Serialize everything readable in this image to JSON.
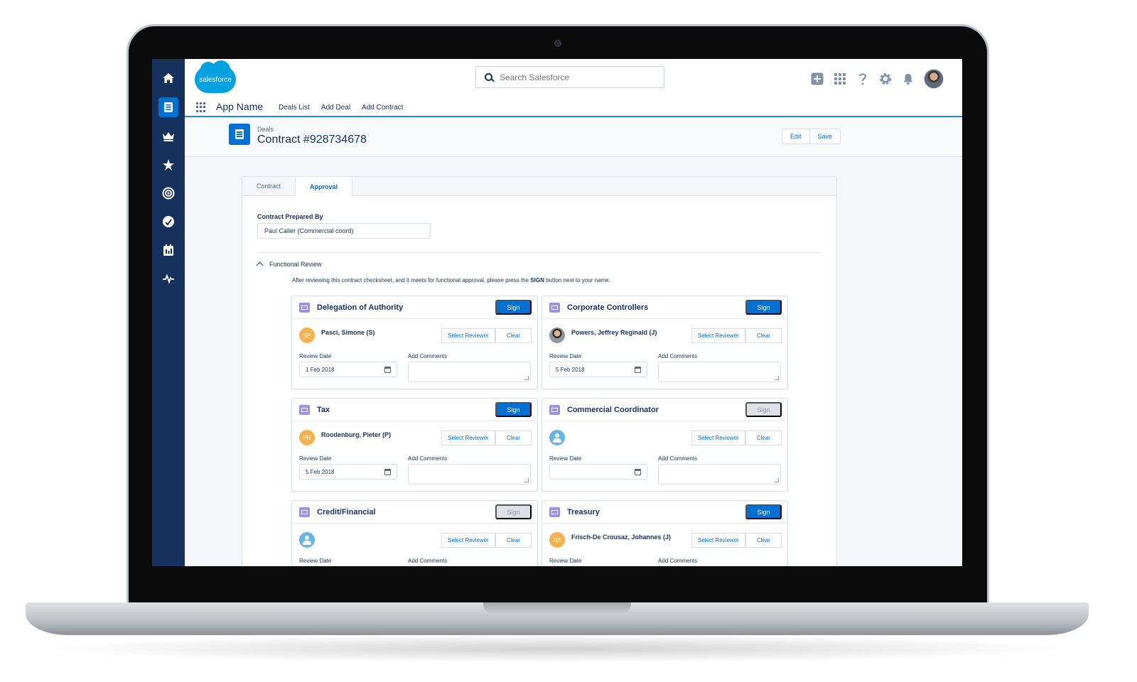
{
  "app": {
    "logo_text": "salesforce",
    "search_placeholder": "Search Salesforce",
    "app_name": "App Name",
    "nav": [
      "Deals List",
      "Add Deal",
      "Add Contract"
    ]
  },
  "sidebar_icons": [
    "home-icon",
    "contract-icon",
    "crown-icon",
    "person-star-icon",
    "target-icon",
    "gauge-icon",
    "calendar-board-icon",
    "pulse-icon"
  ],
  "header_icons": [
    "add-icon",
    "waffle-icon",
    "help-icon",
    "settings-icon",
    "bell-icon",
    "user-avatar"
  ],
  "record": {
    "eyebrow": "Deals",
    "title": "Contract #928734678",
    "edit_label": "Edit",
    "save_label": "Save"
  },
  "tabs": [
    {
      "label": "Contract",
      "active": false
    },
    {
      "label": "Approval",
      "active": true
    }
  ],
  "form": {
    "prepared_by_label": "Contract Prepared By",
    "prepared_by_value": "Paul Caller (Commercial coord)",
    "section_title": "Functional Review",
    "instructions_before": "After reviewing this contract checksheet, and it meets for functional approval, please press the",
    "instructions_bold": "SIGN",
    "instructions_after": "button next to your name."
  },
  "labels": {
    "sign": "Sign",
    "select_reviewer": "Select Reviewer",
    "clear": "Clear",
    "review_date": "Review Date",
    "add_comments": "Add Comments"
  },
  "reviews": [
    {
      "title": "Delegation of Authority",
      "reviewer": "Pasci, Simone (S)",
      "avatar": "initials",
      "initials": "SP",
      "date": "1 Feb 2018",
      "sign_enabled": true
    },
    {
      "title": "Corporate Controllers",
      "reviewer": "Powers, Jeffrey Reginald (J)",
      "avatar": "photo",
      "initials": "",
      "date": "5 Feb 2018",
      "sign_enabled": true
    },
    {
      "title": "Tax",
      "reviewer": "Roodenburg, Pieter (P)",
      "avatar": "initials",
      "initials": "PR",
      "date": "5 Feb 2018",
      "sign_enabled": true
    },
    {
      "title": "Commercial Coordinator",
      "reviewer": "",
      "avatar": "placeholder",
      "initials": "",
      "date": "",
      "sign_enabled": false
    },
    {
      "title": "Credit/Financial",
      "reviewer": "",
      "avatar": "placeholder",
      "initials": "",
      "date": "",
      "sign_enabled": false
    },
    {
      "title": "Treasury",
      "reviewer": "Frisch-De Crousaz, Johannes (J)",
      "avatar": "initials",
      "initials": "NE",
      "date": "",
      "sign_enabled": true
    }
  ]
}
